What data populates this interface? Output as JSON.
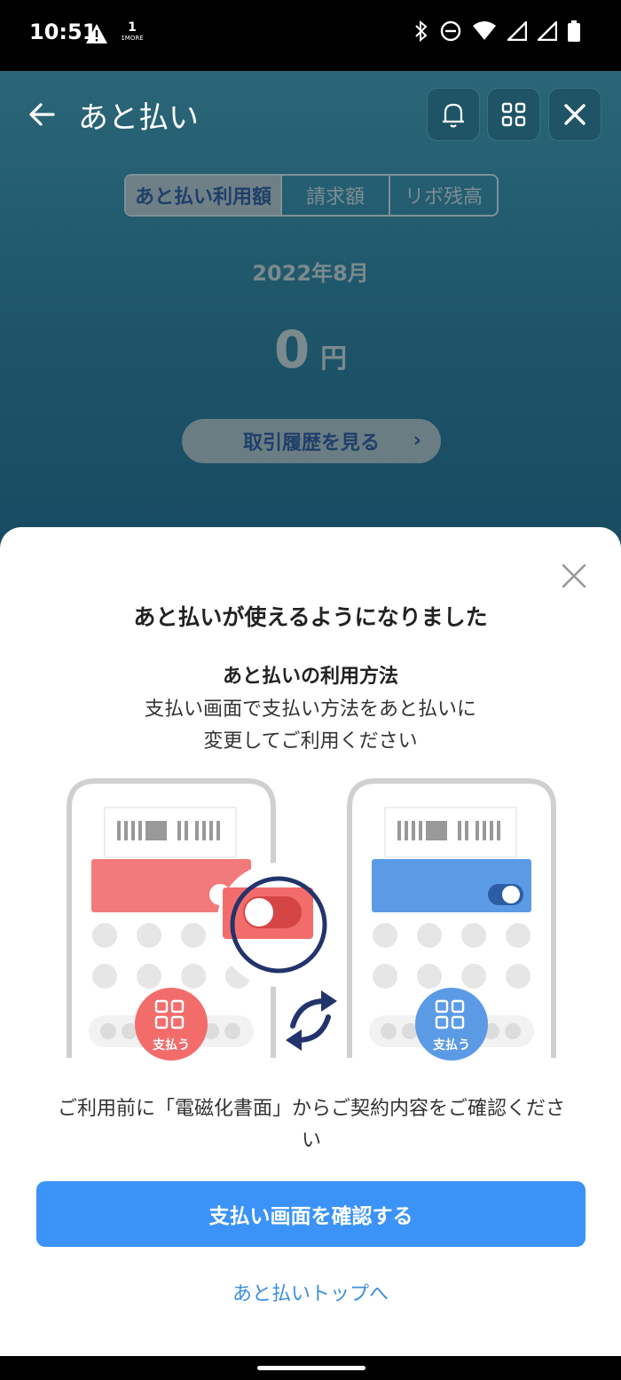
{
  "status_bar": {
    "time": "10:51",
    "carrier_label": "1MORE"
  },
  "header": {
    "title": "あと払い"
  },
  "tabs": [
    {
      "label": "あと払い利用額",
      "active": true
    },
    {
      "label": "請求額",
      "active": false
    },
    {
      "label": "リボ残高",
      "active": false
    }
  ],
  "summary": {
    "month": "2022年8月",
    "amount": "0",
    "unit": "円",
    "history_button": "取引履歴を見る"
  },
  "sheet": {
    "title": "あと払いが使えるようになりました",
    "subtitle": "あと払いの利用方法",
    "description_line1": "支払い画面で支払い方法をあと払いに",
    "description_line2": "変更してご利用ください",
    "illustration": {
      "pay_label_left": "支払う",
      "pay_label_right": "支払う"
    },
    "notice_line1": "ご利用前に「電磁化書面」からご契約内容をご確認くださ",
    "notice_line2": "い",
    "primary_button": "支払い画面を確認する",
    "secondary_link": "あと払いトップへ"
  },
  "colors": {
    "primary": "#3b93f7",
    "red": "#f36c6c",
    "blue": "#5b9be6",
    "navy": "#22346b"
  }
}
